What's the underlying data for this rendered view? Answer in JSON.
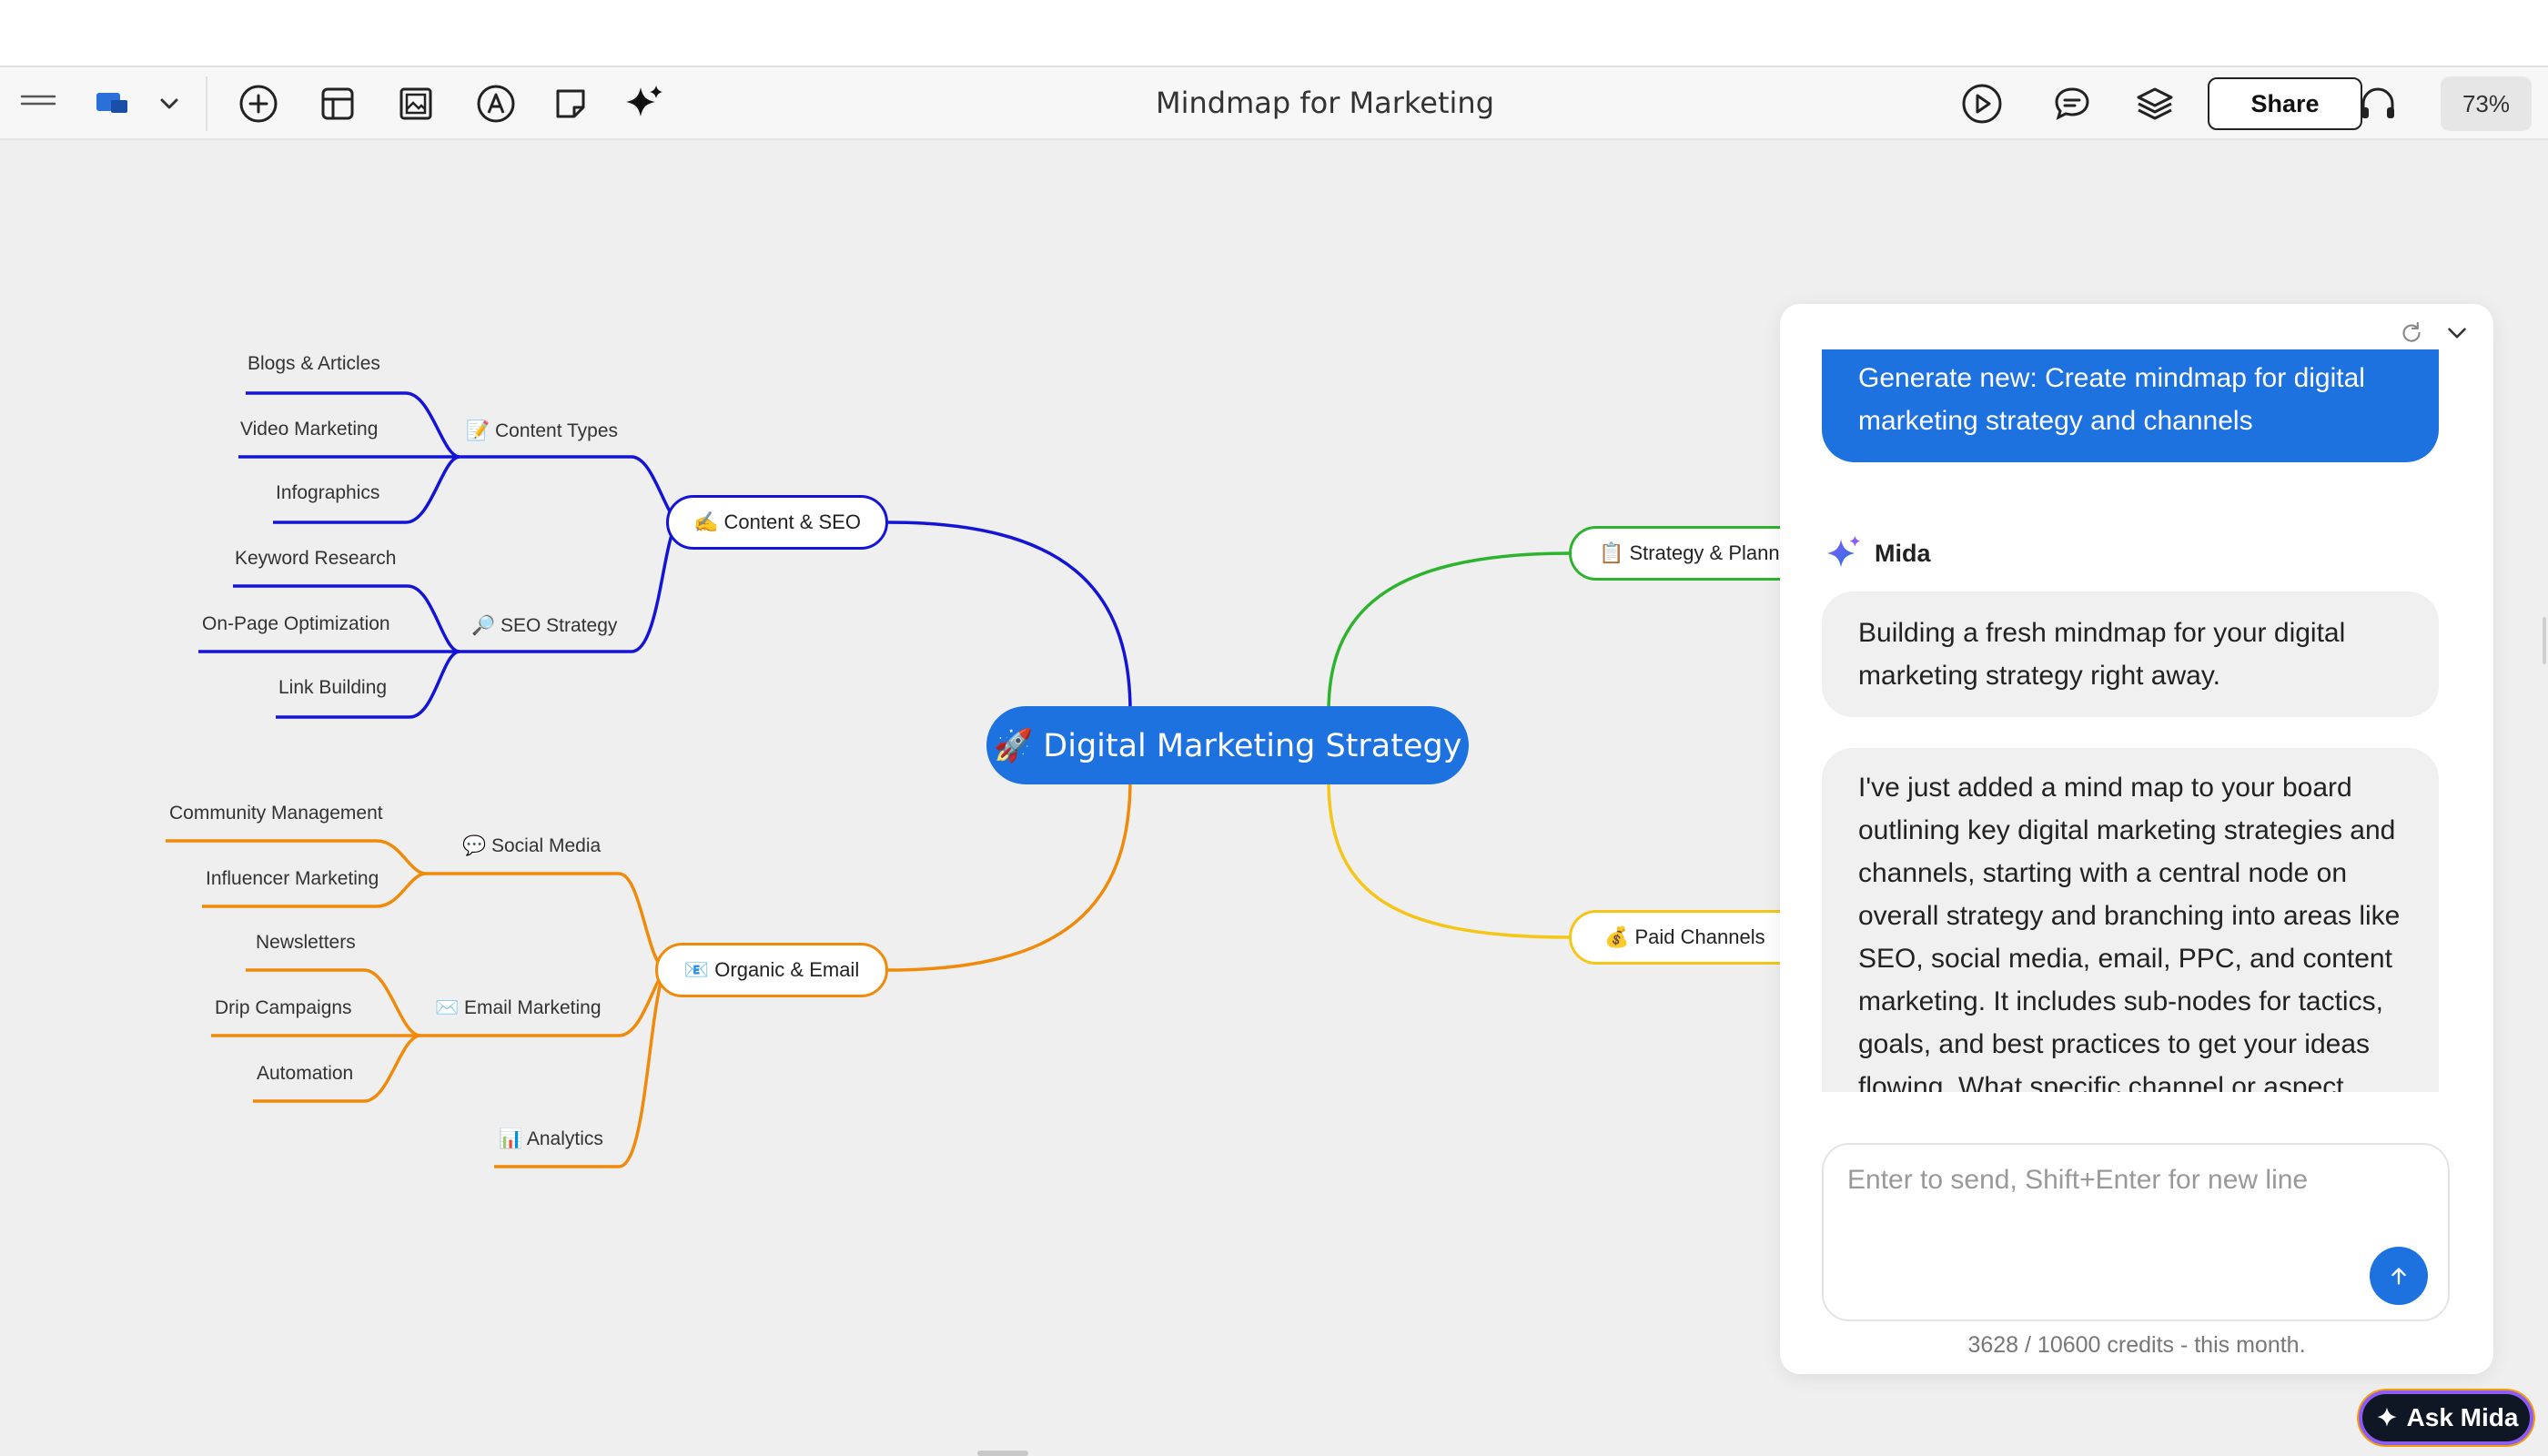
{
  "toolbar": {
    "title": "Mindmap for Marketing",
    "share_label": "Share",
    "zoom": "73%",
    "icons": [
      "menu-icon",
      "board-icon",
      "chevron-down-icon",
      "add-circle-icon",
      "layout-icon",
      "image-icon",
      "pen-icon",
      "sticky-note-icon",
      "sparkle-icon",
      "play-icon",
      "comment-icon",
      "layers-icon",
      "headphones-icon"
    ]
  },
  "mindmap": {
    "central": "🚀 Digital Marketing Strategy",
    "branches": [
      {
        "label": "✍️ Content & SEO",
        "color": "#1414d6"
      },
      {
        "label": "📧 Organic & Email",
        "color": "#f08a0b"
      },
      {
        "label": "📋 Strategy & Planning",
        "color": "#2db32d"
      },
      {
        "label": "💰 Paid Channels",
        "color": "#f5c518"
      }
    ],
    "content_types": "📝 Content Types",
    "seo_strategy": "🔎 SEO Strategy",
    "social_media": "💬 Social Media",
    "email_marketing": "✉️ Email Marketing",
    "analytics": "📊 Analytics",
    "leaves": {
      "blogs": "Blogs & Articles",
      "video": "Video Marketing",
      "infographics": "Infographics",
      "keyword": "Keyword Research",
      "onpage": "On-Page Optimization",
      "links": "Link Building",
      "community": "Community Management",
      "influencer": "Influencer Marketing",
      "newsletters": "Newsletters",
      "drip": "Drip Campaigns",
      "automation": "Automation"
    }
  },
  "chat": {
    "user_message": "Generate new: Create mindmap for digital marketing strategy and channels",
    "assistant_name": "Mida",
    "reply_1": "Building a fresh mindmap for your digital marketing strategy right away.",
    "reply_2": "I've just added a mind map to your board outlining key digital marketing strategies and channels, starting with a central node on overall strategy and branching into areas like SEO, social media, email, PPC, and content marketing. It includes sub-nodes for tactics, goals, and best practices to get your ideas flowing. What specific channel or aspect would you like to expand on next?",
    "input_placeholder": "Enter to send, Shift+Enter for new line",
    "credits": "3628 / 10600 credits - this month."
  },
  "ask_mida_label": "Ask Mida"
}
